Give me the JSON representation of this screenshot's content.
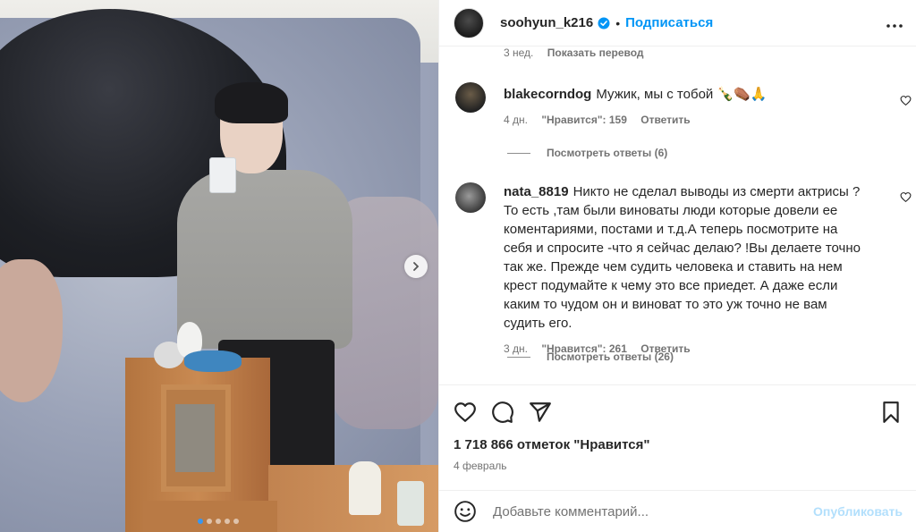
{
  "header": {
    "username": "soohyun_k216",
    "separator": "•",
    "follow_label": "Подписаться",
    "more_icon": "more-horizontal-icon"
  },
  "partial_comment": {
    "time": "3 нед.",
    "translate": "Показать перевод"
  },
  "comments": [
    {
      "username": "blakecorndog",
      "text": "Мужик, мы с тобой 🍾⚰️🙏",
      "time": "4 дн.",
      "likes": "\"Нравится\": 159",
      "reply": "Ответить",
      "view_replies": "Посмотреть ответы (6)"
    },
    {
      "username": "nata_8819",
      "text": "Никто не сделал выводы из смерти актрисы ? То есть ,там были виноваты люди которые довели ее коментариями, постами и т.д.А теперь посмотрите на себя и спросите -что я сейчас делаю? !Вы делаете точно так же. Прежде чем судить человека и ставить на нем крест подумайте к чему это все приедет. А даже если каким то чудом он и виноват то это уж точно не вам судить его.",
      "time": "3 дн.",
      "likes": "\"Нравится\": 261",
      "reply": "Ответить",
      "view_replies": "Посмотреть ответы (26)"
    }
  ],
  "post": {
    "likes_count": "1 718 866 отметок \"Нравится\"",
    "date": "4 февраль"
  },
  "add_comment": {
    "placeholder": "Добавьте комментарий...",
    "publish_label": "Опубликовать"
  },
  "carousel": {
    "slides": 5,
    "active_index": 0
  },
  "colors": {
    "accent": "#0095f6",
    "publish_disabled": "#b2dffc",
    "muted": "#737373"
  }
}
